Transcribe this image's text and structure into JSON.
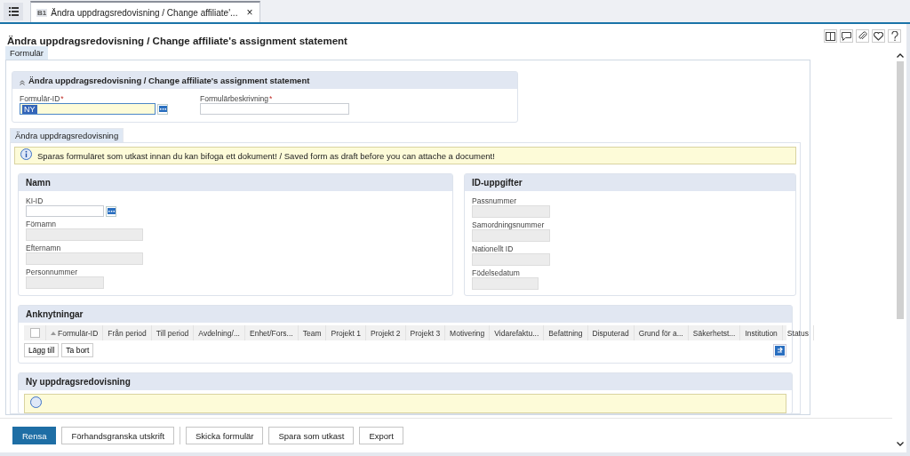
{
  "doc_tab": {
    "badge": "B1",
    "label": "Ändra uppdragsredovisning / Change affiliate'...",
    "close": "×",
    "selected": true
  },
  "title": "Ändra uppdragsredovisning / Change affiliate's assignment statement",
  "form_tabs": [
    {
      "label": "Formulär",
      "selected": true
    }
  ],
  "header_section": {
    "title": "Ändra uppdragsredovisning / Change affiliate's assignment statement",
    "expanded": true,
    "fields": [
      {
        "label": "Formulär-ID",
        "required_mark": "*",
        "value": "NY",
        "kind": "lookup"
      },
      {
        "label": "Formulärbeskrivning",
        "required_mark": "*",
        "kind": "text"
      }
    ]
  },
  "sub_tabs": [
    {
      "label": "Ändra uppdragsredovisning",
      "selected": true
    }
  ],
  "info_message": "Sparas formuläret som utkast innan du kan bifoga ett dokument! / Saved form as draft before you can attache a document!",
  "name_panel": {
    "title": "Namn",
    "fields": [
      {
        "label": "KI-ID",
        "kind": "lookup"
      },
      {
        "label": "Förnamn",
        "kind": "long"
      },
      {
        "label": "Efternamn",
        "kind": "long"
      },
      {
        "label": "Personnummer",
        "kind": "short"
      }
    ]
  },
  "id_panel": {
    "title": "ID-uppgifter",
    "fields": [
      {
        "label": "Passnummer",
        "kind": "short"
      },
      {
        "label": "Samordningsnummer",
        "kind": "short"
      },
      {
        "label": "Nationellt ID",
        "kind": "short"
      },
      {
        "label": "Födelsedatum",
        "kind": "shorter"
      }
    ]
  },
  "links_panel": {
    "title": "Anknytningar",
    "columns": [
      {
        "label": "Formulär-ID",
        "sorted": true
      },
      {
        "label": "Från period",
        "sorted": false
      },
      {
        "label": "Till period",
        "sorted": false
      },
      {
        "label": "Avdelning/...",
        "sorted": false
      },
      {
        "label": "Enhet/Fors...",
        "sorted": false
      },
      {
        "label": "Team",
        "sorted": false
      },
      {
        "label": "Projekt 1",
        "sorted": false
      },
      {
        "label": "Projekt 2",
        "sorted": false
      },
      {
        "label": "Projekt 3",
        "sorted": false
      },
      {
        "label": "Motivering",
        "sorted": false
      },
      {
        "label": "Vidarefaktu...",
        "sorted": false
      },
      {
        "label": "Befattning",
        "sorted": false
      },
      {
        "label": "Disputerad",
        "sorted": false
      },
      {
        "label": "Grund för a...",
        "sorted": false
      },
      {
        "label": "Säkerhetst...",
        "sorted": false
      },
      {
        "label": "Institution",
        "sorted": false
      },
      {
        "label": "Status",
        "sorted": false
      }
    ],
    "select_all_checked": false,
    "buttons": [
      "Lägg till",
      "Ta bort"
    ]
  },
  "new_panel": {
    "title": "Ny uppdragsredovisning"
  },
  "footer_buttons": [
    {
      "label": "Rensa",
      "primary": true
    },
    {
      "label": "Förhandsgranska utskrift",
      "primary": false
    },
    {
      "label": "Skicka formulär",
      "primary": false
    },
    {
      "label": "Spara som utkast",
      "primary": false
    },
    {
      "label": "Export",
      "primary": false
    }
  ]
}
